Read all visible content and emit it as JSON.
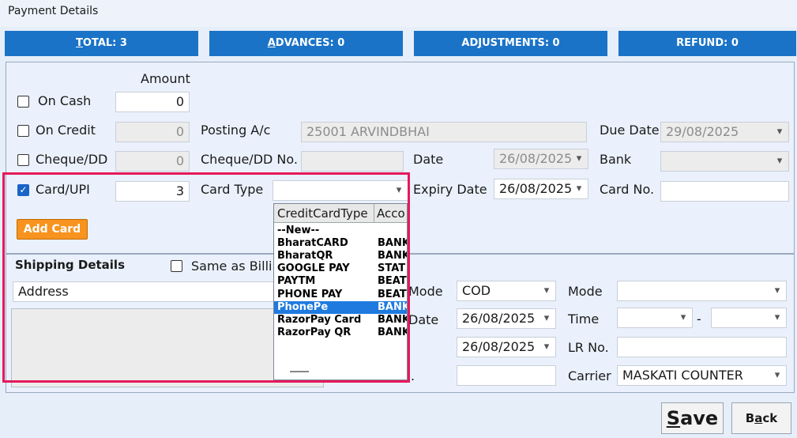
{
  "window": {
    "title": "Payment Details"
  },
  "tabs": [
    {
      "label": "TOTAL: 3",
      "accel": "T"
    },
    {
      "label": "ADVANCES: 0",
      "accel": "A"
    },
    {
      "label": "ADJUSTMENTS: 0",
      "accel": "J"
    },
    {
      "label": "REFUND: 0",
      "accel": ""
    }
  ],
  "payment": {
    "amount_header": "Amount",
    "on_cash": {
      "label": "On Cash",
      "checked": false,
      "amount": "0"
    },
    "on_credit": {
      "label": "On Credit",
      "checked": false,
      "amount": "0"
    },
    "cheque": {
      "label": "Cheque/DD",
      "checked": false,
      "amount": "0"
    },
    "card": {
      "label": "Card/UPI",
      "checked": true,
      "amount": "3"
    },
    "posting_label": "Posting A/c",
    "posting_value": "25001 ARVINDBHAI",
    "due_date_label": "Due Date",
    "due_date_value": "29/08/2025",
    "cheque_no_label": "Cheque/DD No.",
    "cheque_no_value": "",
    "date_label": "Date",
    "date_value": "26/08/2025",
    "bank_label": "Bank",
    "bank_value": "",
    "card_type_label": "Card Type",
    "card_type_value": "",
    "expiry_label": "Expiry Date",
    "expiry_value": "26/08/2025",
    "card_no_label": "Card No.",
    "card_no_value": "",
    "add_card_label": "Add Card"
  },
  "card_dropdown": {
    "columns": [
      "CreditCardType",
      "Acco"
    ],
    "rows": [
      {
        "type": "--New--",
        "account": ""
      },
      {
        "type": "BharatCARD",
        "account": "BANK"
      },
      {
        "type": "BharatQR",
        "account": "BANK"
      },
      {
        "type": "GOOGLE PAY",
        "account": "STAT"
      },
      {
        "type": "PAYTM",
        "account": "BEAT"
      },
      {
        "type": "PHONE PAY",
        "account": "BEAT"
      },
      {
        "type": "PhonePe",
        "account": "BANK"
      },
      {
        "type": "RazorPay Card",
        "account": "BANK"
      },
      {
        "type": "RazorPay QR",
        "account": "BANK"
      }
    ],
    "selected_index": 6
  },
  "shipping": {
    "title": "Shipping Details",
    "same_as_billing_label": "Same as Billin",
    "address_label": "Address",
    "address_value": "",
    "mode_label_a": "Mode",
    "mode_value_a": "COD",
    "mode_label_b": "Mode",
    "mode_value_b": "",
    "date_label": "Date",
    "date_value_a": "26/08/2025",
    "date_value_b": "26/08/2025",
    "time_label": "Time",
    "time_dash": "-",
    "lr_no_label": "LR No.",
    "lr_no_value": "",
    "small_label": ".",
    "small_value": "",
    "carrier_label": "Carrier",
    "carrier_value": "MASKATI COUNTER"
  },
  "footer": {
    "save_label": "Save",
    "back_label": "Back"
  },
  "icons": {
    "dropdown": "▾",
    "check": "✓"
  }
}
